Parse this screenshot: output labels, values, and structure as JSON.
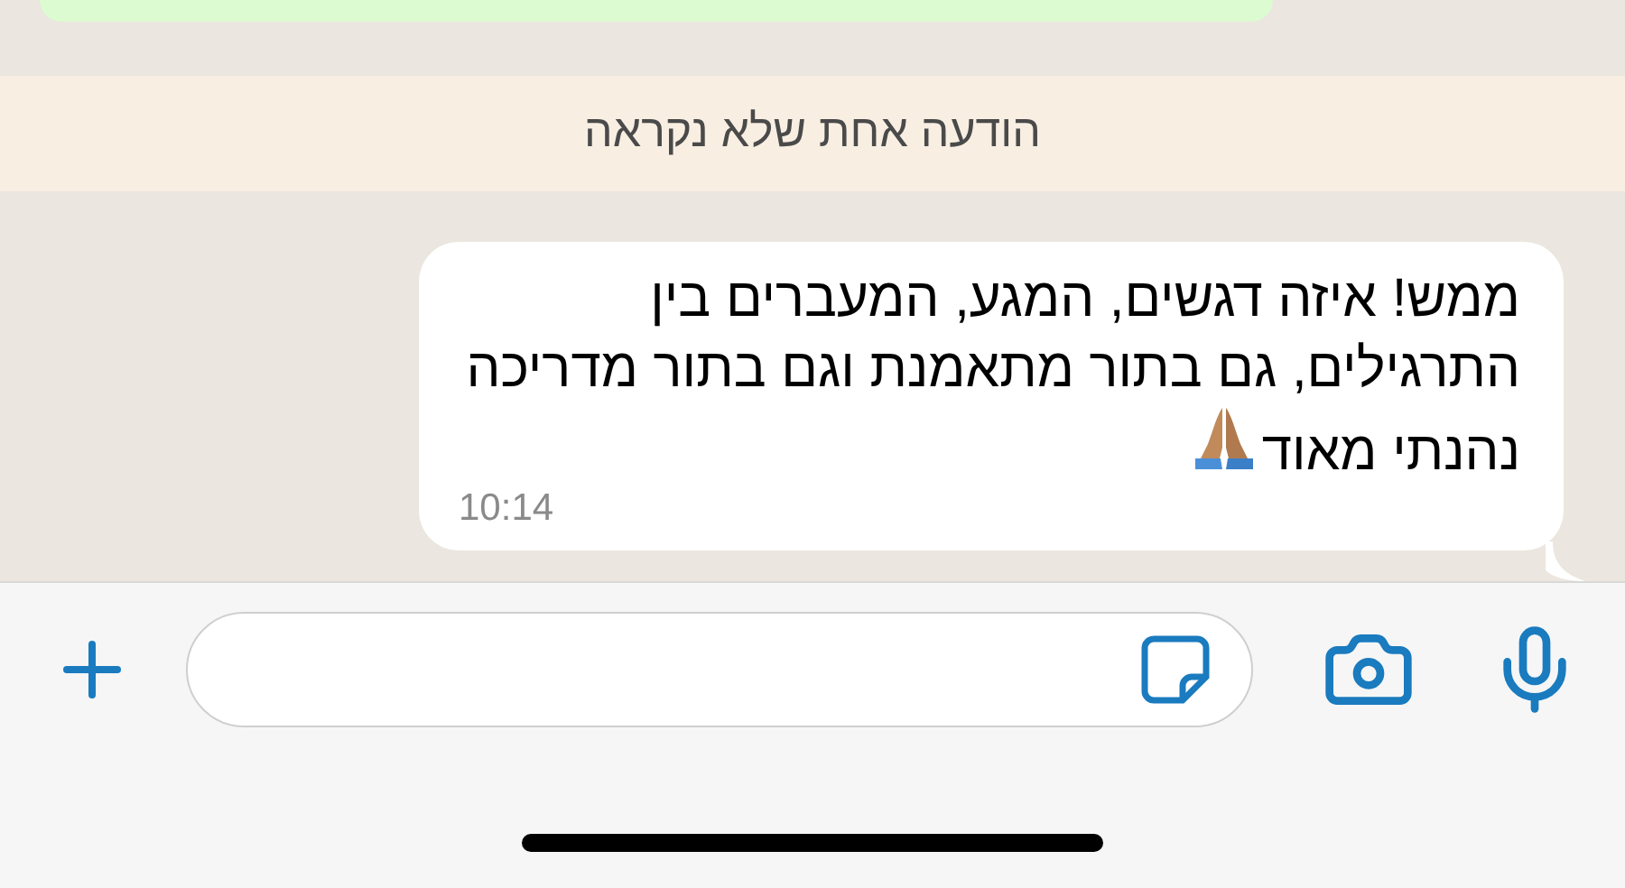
{
  "unread_banner": "הודעה אחת שלא נקראה",
  "message": {
    "text": "ממש! איזה דגשים, המגע, המעברים בין התרגילים, גם בתור מתאמנת וגם בתור מדריכה נהנתי מאוד",
    "time": "10:14"
  }
}
